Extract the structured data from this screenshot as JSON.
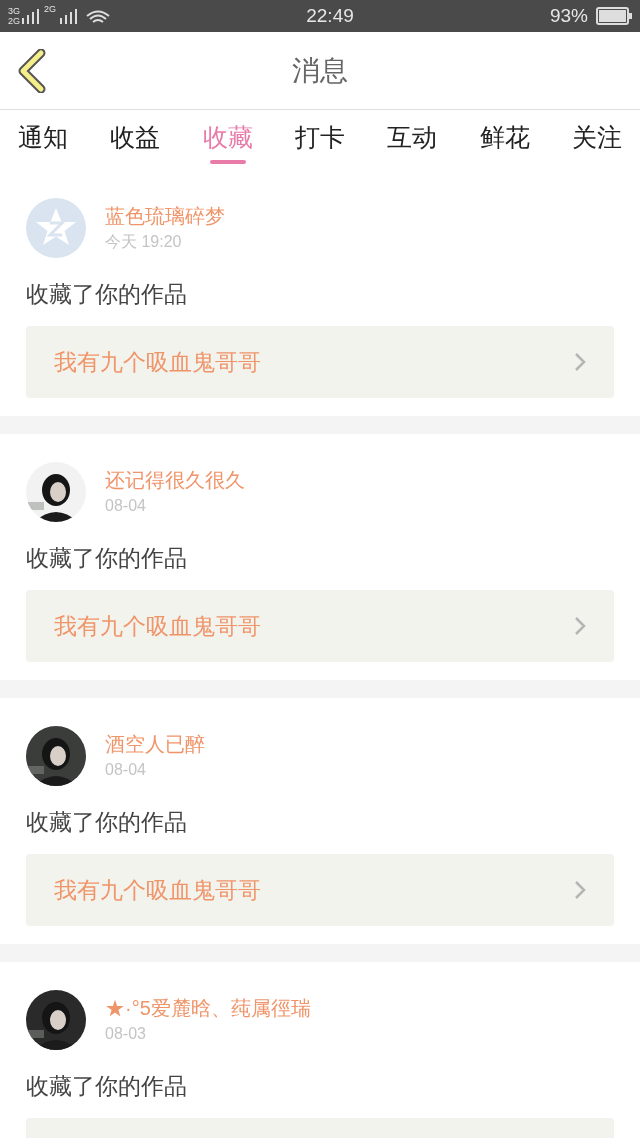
{
  "status_bar": {
    "network_top": "3G",
    "network_bottom": "2G",
    "network_second": "2G",
    "time": "22:49",
    "battery": "93%"
  },
  "header": {
    "title": "消息"
  },
  "tabs": [
    {
      "label": "通知",
      "selected": false
    },
    {
      "label": "收益",
      "selected": false
    },
    {
      "label": "收藏",
      "selected": true
    },
    {
      "label": "打卡",
      "selected": false
    },
    {
      "label": "互动",
      "selected": false
    },
    {
      "label": "鲜花",
      "selected": false
    },
    {
      "label": "关注",
      "selected": false
    }
  ],
  "messages": [
    {
      "avatar": {
        "kind": "default"
      },
      "name": "蓝色琉璃碎梦",
      "time": "今天 19:20",
      "action": "收藏了你的作品",
      "work": "我有九个吸血鬼哥哥"
    },
    {
      "name": "还记得很久很久",
      "time": "08-04",
      "action": "收藏了你的作品",
      "work": "我有九个吸血鬼哥哥"
    },
    {
      "name": "酒空人已醉",
      "time": "08-04",
      "action": "收藏了你的作品",
      "work": "我有九个吸血鬼哥哥"
    },
    {
      "name": "★·°5爱麓晗、莼属徑瑞",
      "time": "08-03",
      "action": "收藏了你的作品"
    }
  ]
}
